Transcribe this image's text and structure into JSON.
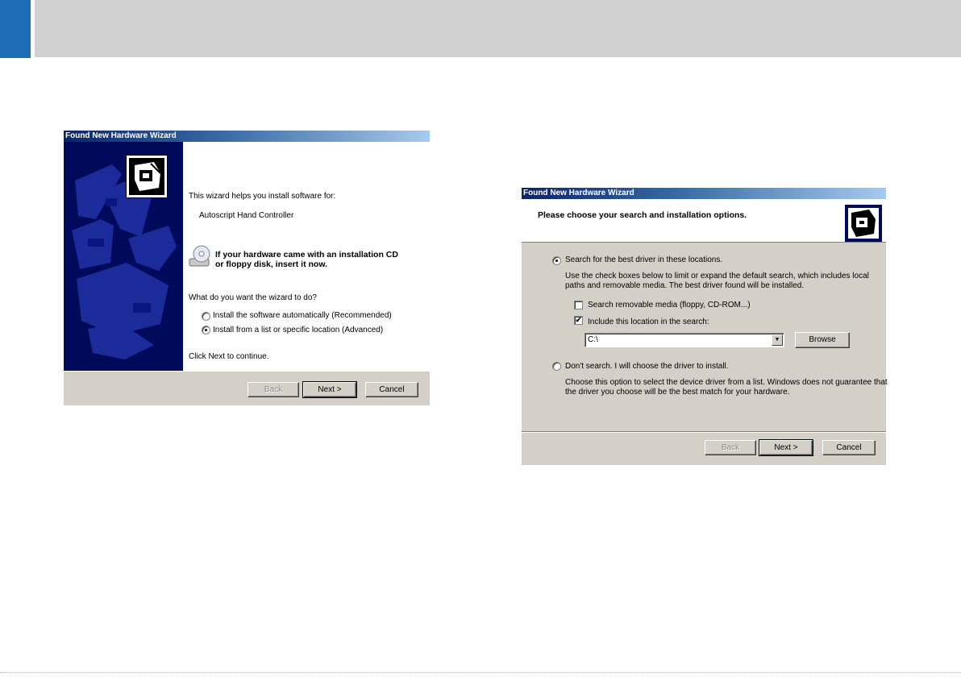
{
  "wizard1": {
    "title": "Found New Hardware Wizard",
    "intro": "This wizard helps you install software for:",
    "device": "Autoscript Hand Controller",
    "cd_prompt_line1": "If your hardware came with an installation CD",
    "cd_prompt_line2": "or floppy disk, insert it now.",
    "question": "What do you want the wizard to do?",
    "options": [
      {
        "label": "Install the software automatically (Recommended)",
        "selected": false
      },
      {
        "label": "Install from a list or specific location (Advanced)",
        "selected": true
      }
    ],
    "footer_text": "Click Next to continue.",
    "buttons": {
      "back": "Back",
      "next": "Next >",
      "cancel": "Cancel"
    }
  },
  "wizard2": {
    "title": "Found New Hardware Wizard",
    "heading": "Please choose your search and installation options.",
    "search_option": "Search for the best driver in these locations.",
    "search_desc_line1": "Use the check boxes below to limit or expand the default search, which includes local",
    "search_desc_line2": "paths and removable media. The best driver found will be installed.",
    "checkbox_removable": {
      "label": "Search removable media (floppy, CD-ROM...)",
      "checked": false
    },
    "checkbox_location": {
      "label": "Include this location in the search:",
      "checked": true
    },
    "location_value": "C:\\",
    "browse": "Browse",
    "dont_search_option": "Don't search. I will choose the driver to install.",
    "dont_search_desc_line1": "Choose this option to select the device driver from a list.  Windows does not guarantee that",
    "dont_search_desc_line2": "the driver you choose will be the best match for your hardware.",
    "buttons": {
      "back": "Back",
      "next": "Next >",
      "cancel": "Cancel"
    }
  }
}
